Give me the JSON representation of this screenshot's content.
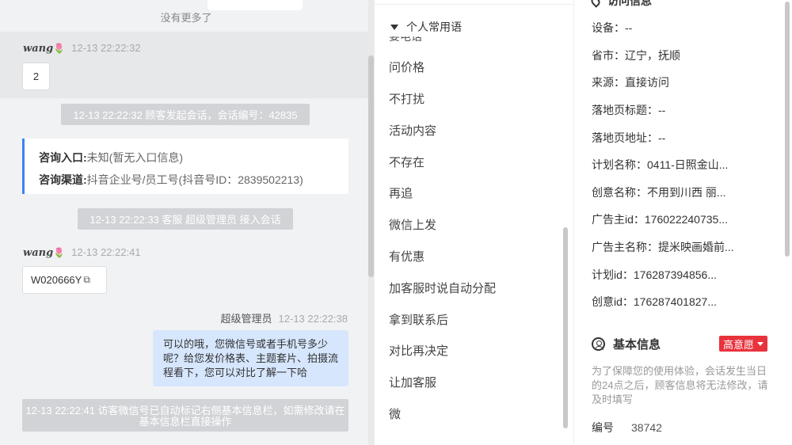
{
  "chat": {
    "no_more": "没有更多了",
    "messages": [
      {
        "sender": "wang",
        "emoji": "🌷",
        "time": "12-13 22:22:32",
        "text": "2"
      },
      {
        "sender": "wang",
        "emoji": "🌷",
        "time": "12-13 22:22:41",
        "text": "W020666Y"
      }
    ],
    "system": [
      "12-13 22:22:32 顾客发起会话，会话编号：42835",
      "12-13 22:22:33 客服 超级管理员 接入会话",
      "12-13 22:22:41 访客微信号已自动标记右侧基本信息栏，如需修改请在基本信息栏直接操作"
    ],
    "info_card": {
      "entry_label": "咨询入口:",
      "entry_value": "未知(暂无入口信息)",
      "channel_label": "咨询渠道:",
      "channel_value": "抖音企业号/员工号(抖音号ID：2839502213)"
    },
    "agent": {
      "name": "超级管理员",
      "time": "12-13 22:22:38",
      "text": "可以的哦，您微信号或者手机号多少呢？给您发价格表、主题套片、拍摄流程看下，您可以对比了解一下哈"
    },
    "copy_icon": "copy-icon"
  },
  "phrases": {
    "group_title": "个人常用语",
    "hidden_item": "要电话",
    "items": [
      "问价格",
      "不打扰",
      "活动内容",
      "不存在",
      "再追",
      "微信上发",
      "有优惠",
      "加客服时说自动分配",
      "拿到联系后",
      "对比再决定",
      "让加客服",
      "微"
    ]
  },
  "info": {
    "partial_heading": "访问信息",
    "fields": [
      "设备：--",
      "省市：辽宁，抚顺",
      "来源：直接访问",
      "落地页标题：--",
      "落地页地址：--",
      "计划名称：0411-日照金山...",
      "创意名称：不用到川西 丽...",
      "广告主id：176022240735...",
      "广告主名称：提米映画婚前...",
      "计划id：176287394856...",
      "创意id：176287401827..."
    ],
    "basic": {
      "title": "基本信息",
      "tag": "高意愿",
      "notice": "为了保障您的使用体验，会话发生当日的24点之后，顾客信息将无法修改，请及时填写",
      "id_label": "编号",
      "id_value": "38742"
    }
  }
}
